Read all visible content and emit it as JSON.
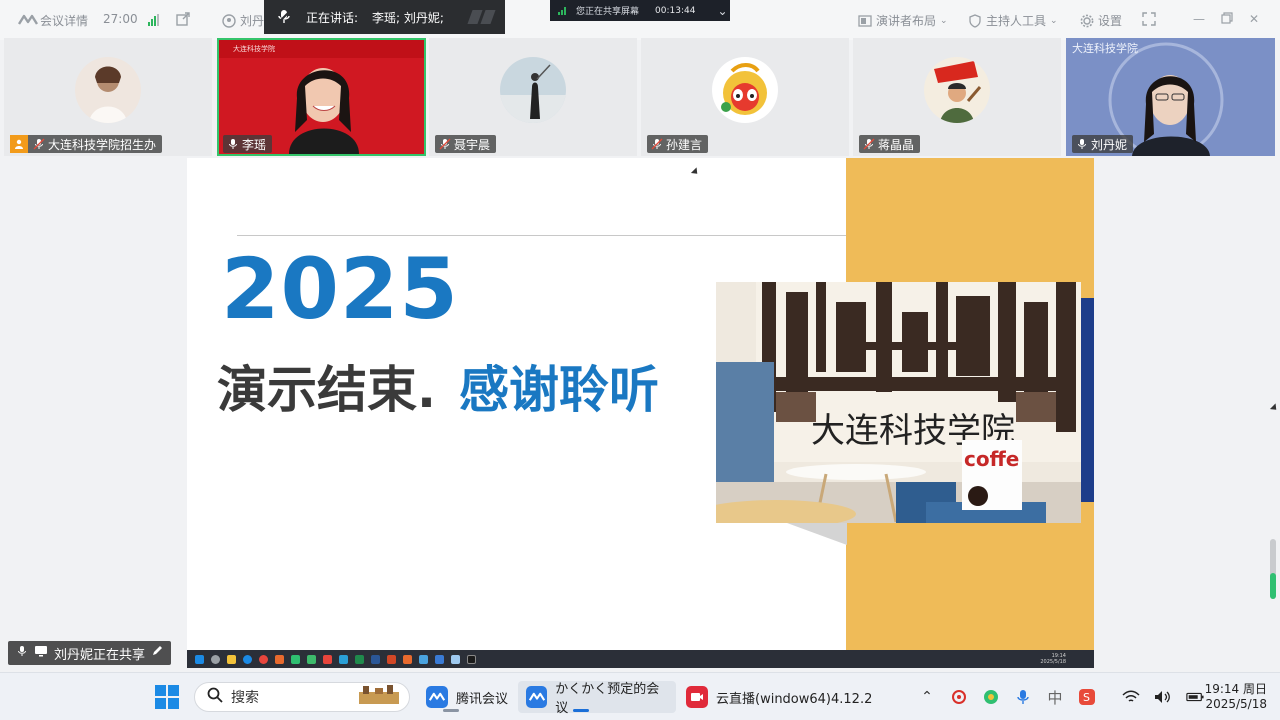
{
  "toolbar": {
    "meeting_details": "会议详情",
    "duration": "27:00",
    "presenter_short": "刘丹",
    "presenter_layout": "演讲者布局",
    "host_tools": "主持人工具",
    "settings": "设置"
  },
  "speaking_banner": {
    "label": "正在讲话:",
    "names": "李瑶; 刘丹妮;"
  },
  "share_banner": {
    "label": "您正在共享屏幕",
    "time": "00:13:44"
  },
  "participants": [
    {
      "name": "大连科技学院招生办",
      "host": true
    },
    {
      "name": "李瑶",
      "active_speaker": true
    },
    {
      "name": "聂宇晨"
    },
    {
      "name": "孙建言"
    },
    {
      "name": "蒋晶晶"
    },
    {
      "name": "刘丹妮"
    }
  ],
  "slide": {
    "year": "2025",
    "title_dark": "演示结束.",
    "title_blue": "感谢聆听",
    "photo_sign": "大连科技学院",
    "cup_text": "coffe",
    "colors": {
      "blue": "#1a78c2",
      "gold": "#efbb58",
      "navy": "#1d3d8a"
    },
    "inner_clock_time": "19:14",
    "inner_clock_date": "2025/5/18"
  },
  "sharing_label": "刘丹妮正在共享",
  "taskbar": {
    "search_placeholder": "搜索",
    "apps": [
      {
        "label": "腾讯会议",
        "icon": "tencent-meeting-icon"
      },
      {
        "label": "かくかく预定的会议",
        "icon": "tencent-meeting-icon",
        "active": true
      },
      {
        "label": "云直播(window64)4.12.2",
        "icon": "live-broadcast-icon"
      }
    ],
    "time": "19:14 周日",
    "date": "2025/5/18"
  }
}
